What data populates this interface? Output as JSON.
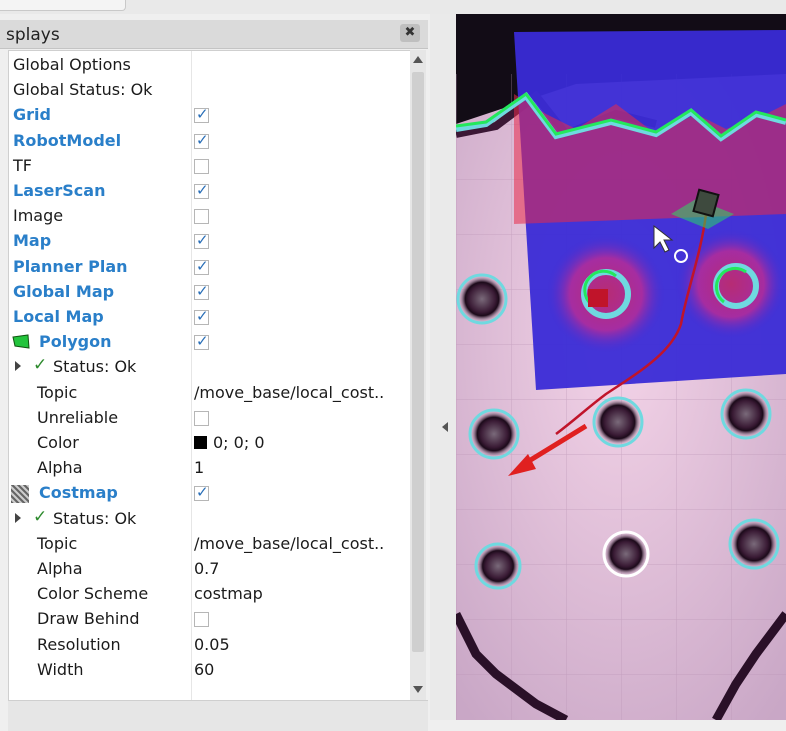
{
  "panel": {
    "title": "splays",
    "close_label": "✖"
  },
  "tree": {
    "rows": [
      {
        "name": "Global Options",
        "style": "plain",
        "value": ""
      },
      {
        "name": "Global Status: Ok",
        "style": "plain",
        "value": ""
      },
      {
        "name": "Grid",
        "style": "blue",
        "checked": true
      },
      {
        "name": "RobotModel",
        "style": "blue",
        "checked": true
      },
      {
        "name": "TF",
        "style": "plain",
        "checked": false
      },
      {
        "name": "LaserScan",
        "style": "blue",
        "checked": true
      },
      {
        "name": "Image",
        "style": "plain",
        "checked": false
      },
      {
        "name": "Map",
        "style": "blue",
        "checked": true
      },
      {
        "name": "Planner Plan",
        "style": "blue",
        "checked": true
      },
      {
        "name": "Global Map",
        "style": "blue",
        "checked": true
      },
      {
        "name": "Local Map",
        "style": "blue",
        "checked": true
      },
      {
        "name": "Polygon",
        "style": "blue",
        "checked": true,
        "icon": "polygon-icon"
      },
      {
        "name": "Status: Ok",
        "style": "status"
      },
      {
        "name": "Topic",
        "style": "prop",
        "value": "/move_base/local_cost.."
      },
      {
        "name": "Unreliable",
        "style": "prop",
        "checked": false
      },
      {
        "name": "Color",
        "style": "prop",
        "value": "0; 0; 0",
        "swatch": "#000000"
      },
      {
        "name": "Alpha",
        "style": "prop",
        "value": "1"
      },
      {
        "name": "Costmap",
        "style": "blue",
        "checked": true,
        "icon": "costmap-icon"
      },
      {
        "name": "Status: Ok",
        "style": "status"
      },
      {
        "name": "Topic",
        "style": "prop",
        "value": "/move_base/local_cost.."
      },
      {
        "name": "Alpha",
        "style": "prop",
        "value": "0.7"
      },
      {
        "name": "Color Scheme",
        "style": "prop",
        "value": "costmap"
      },
      {
        "name": "Draw Behind",
        "style": "prop",
        "checked": false
      },
      {
        "name": "Resolution",
        "style": "prop",
        "value": "0.05"
      },
      {
        "name": "Width",
        "style": "prop",
        "value": "60"
      }
    ]
  },
  "colors": {
    "blue_label": "#2a7fc9",
    "check_color": "#2a6fb8",
    "status_ok": "#2e8b2e",
    "costmap_blue": "#3a2bd6",
    "inflation_red": "#e8294a",
    "path_red": "#c0142a",
    "laser_green": "#23e85c",
    "obstacle_cyan": "#6fd9e0"
  },
  "icons": [
    "polygon-icon",
    "costmap-icon",
    "expand-arrow-icon",
    "checkmark-icon",
    "close-icon",
    "scroll-up-icon",
    "scroll-down-icon",
    "collapse-arrow-icon",
    "mouse-cursor-icon",
    "robot-icon",
    "goal-arrow-icon"
  ]
}
